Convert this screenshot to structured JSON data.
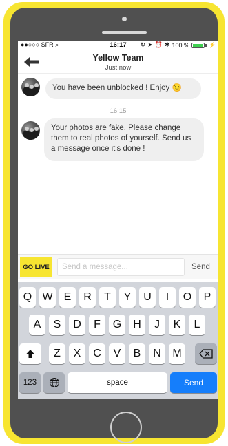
{
  "status_bar": {
    "carrier": "●●○○○ SFR",
    "time": "16:17",
    "battery_text": "100 %",
    "battery_level": 1.0
  },
  "header": {
    "title": "Yellow Team",
    "subtitle": "Just now"
  },
  "messages": [
    {
      "text": "You have been unblocked ! Enjoy 😉"
    },
    {
      "timestamp": "16:15"
    },
    {
      "text": "Your photos are fake. Please change them to real photos of yourself. Send us a message once it's done !"
    }
  ],
  "composer": {
    "go_live_label": "GO LIVE",
    "placeholder": "Send a message...",
    "send_label": "Send"
  },
  "keyboard": {
    "row1": [
      "Q",
      "W",
      "E",
      "R",
      "T",
      "Y",
      "U",
      "I",
      "O",
      "P"
    ],
    "row2": [
      "A",
      "S",
      "D",
      "F",
      "G",
      "H",
      "J",
      "K",
      "L"
    ],
    "row3": [
      "Z",
      "X",
      "C",
      "V",
      "B",
      "N",
      "M"
    ],
    "numbers_label": "123",
    "space_label": "space",
    "send_label": "Send"
  },
  "colors": {
    "frame": "#f7e531",
    "accent_send": "#157efb"
  }
}
